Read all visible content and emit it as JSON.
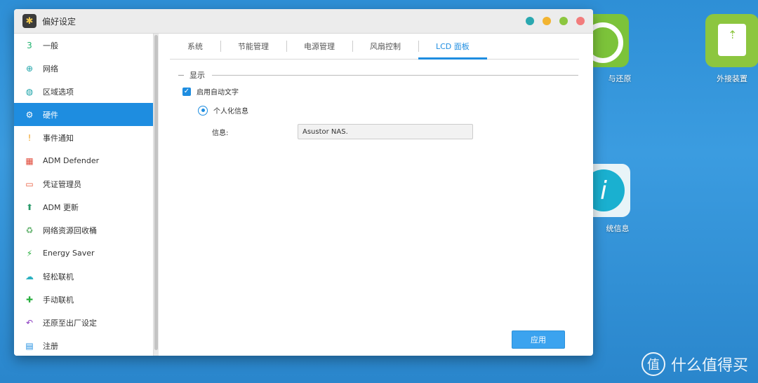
{
  "window": {
    "title": "偏好设定"
  },
  "sidebar": {
    "items": [
      {
        "label": "一般",
        "icon": "general-icon",
        "color": "#1eb26e"
      },
      {
        "label": "网络",
        "icon": "globe-icon",
        "color": "#1aa3a8"
      },
      {
        "label": "区域选项",
        "icon": "region-globe-icon",
        "color": "#1aa3a8"
      },
      {
        "label": "硬件",
        "icon": "hardware-icon",
        "color": "#1e8de0"
      },
      {
        "label": "事件通知",
        "icon": "alert-icon",
        "color": "#f0a020"
      },
      {
        "label": "ADM Defender",
        "icon": "firewall-icon",
        "color": "#e04a3a"
      },
      {
        "label": "凭证管理员",
        "icon": "certificate-icon",
        "color": "#e85a3a"
      },
      {
        "label": "ADM 更新",
        "icon": "update-icon",
        "color": "#2a9a6a"
      },
      {
        "label": "网络资源回收桶",
        "icon": "recycle-bin-icon",
        "color": "#5fb06a"
      },
      {
        "label": "Energy Saver",
        "icon": "energy-icon",
        "color": "#2ab040"
      },
      {
        "label": "轻松联机",
        "icon": "cloud-icon",
        "color": "#2ab0c0"
      },
      {
        "label": "手动联机",
        "icon": "connect-icon",
        "color": "#2ab040"
      },
      {
        "label": "还原至出厂设定",
        "icon": "restore-icon",
        "color": "#8a3ac0"
      },
      {
        "label": "注册",
        "icon": "register-icon",
        "color": "#1e8de0"
      }
    ]
  },
  "tabs": [
    {
      "label": "系统"
    },
    {
      "label": "节能管理"
    },
    {
      "label": "电源管理"
    },
    {
      "label": "风扇控制"
    },
    {
      "label": "LCD 面板"
    }
  ],
  "panel": {
    "section_title": "显示",
    "enable_label": "启用自动文字",
    "radio_label": "个人化信息",
    "field_label": "信息:",
    "field_value": "Asustor NAS.",
    "apply_label": "应用"
  },
  "desktop": {
    "icon1_label": "与还原",
    "icon2_label": "外接装置",
    "icon3_label": "统信息"
  },
  "watermark": {
    "text": "什么值得买",
    "logo": "值"
  }
}
